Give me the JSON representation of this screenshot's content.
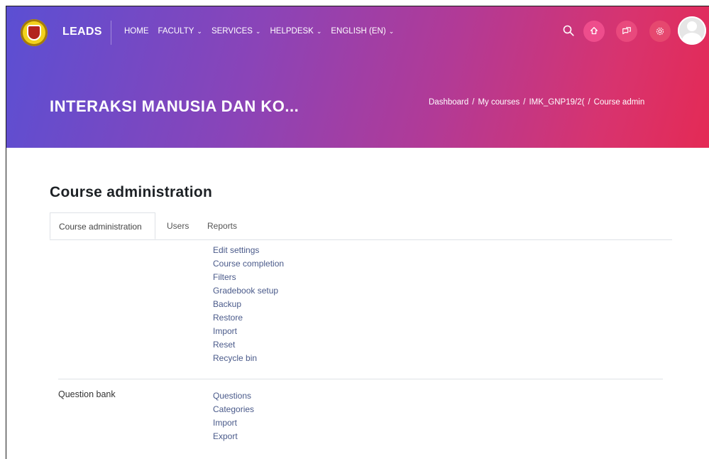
{
  "header": {
    "brand": "LEADS",
    "nav": [
      {
        "label": "HOME",
        "has_dropdown": false
      },
      {
        "label": "FACULTY",
        "has_dropdown": true
      },
      {
        "label": "SERVICES",
        "has_dropdown": true
      },
      {
        "label": "HELPDESK",
        "has_dropdown": true
      },
      {
        "label": "ENGLISH (EN)",
        "has_dropdown": true
      }
    ],
    "chevron": "⌄",
    "icons": [
      "search-icon",
      "notification-icon",
      "messages-icon",
      "settings-icon",
      "avatar"
    ]
  },
  "hero": {
    "course_title": "INTERAKSI MANUSIA DAN KO...",
    "breadcrumb": [
      "Dashboard",
      "My courses",
      "IMK_GNP19/2(",
      "Course admin"
    ],
    "breadcrumb_separator": "/",
    "gradient_colors": [
      "#5b4fd3",
      "#b23a96",
      "#e42a55"
    ]
  },
  "page": {
    "heading": "Course administration",
    "tabs": [
      "Course administration",
      "Users",
      "Reports"
    ],
    "active_tab": "Course administration"
  },
  "sections": [
    {
      "label": "",
      "links": [
        "Edit settings",
        "Course completion",
        "Filters",
        "Gradebook setup",
        "Backup",
        "Restore",
        "Import",
        "Reset",
        "Recycle bin"
      ]
    },
    {
      "label": "Question bank",
      "links": [
        "Questions",
        "Categories",
        "Import",
        "Export"
      ]
    }
  ],
  "colors": {
    "link": "#4a5a8a",
    "heading": "#1d2125",
    "accent_pink": "#ee4d8c"
  }
}
